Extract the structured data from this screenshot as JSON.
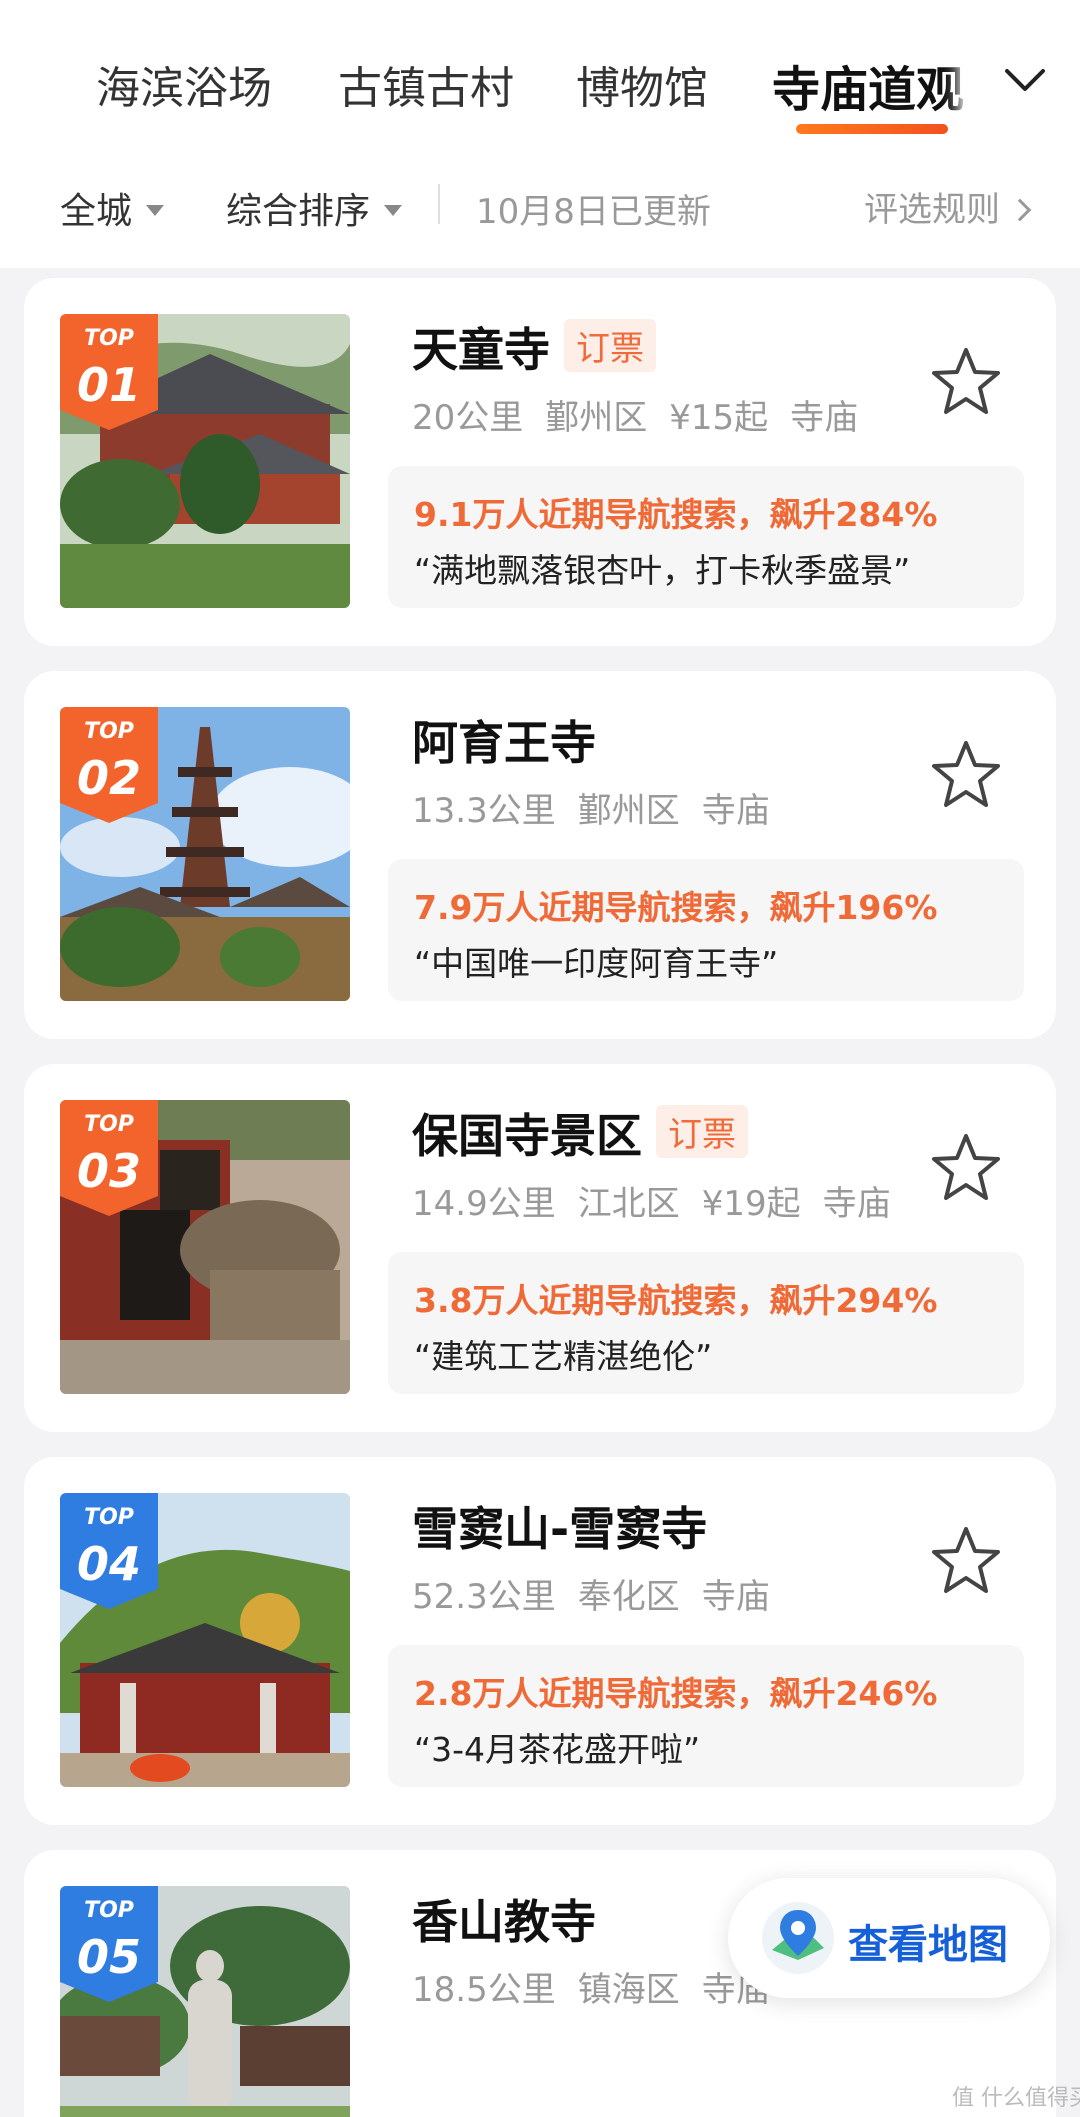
{
  "tabs": {
    "items": [
      "海滨浴场",
      "古镇古村",
      "博物馆",
      "寺庙道观"
    ],
    "active_index": 3
  },
  "filters": {
    "area": "全城",
    "sort": "综合排序",
    "updated": "10月8日已更新",
    "rules": "评选规则"
  },
  "list": [
    {
      "badge_top": "TOP",
      "rank": "01",
      "badge_color": "#f2642b",
      "name": "天童寺",
      "ticket": "订票",
      "distance": "20公里",
      "district": "鄞州区",
      "price": "¥15起",
      "category": "寺庙",
      "hot": "9.1万人近期导航搜索，飙升284%",
      "quote": "“满地飘落银杏叶，打卡秋季盛景”"
    },
    {
      "badge_top": "TOP",
      "rank": "02",
      "badge_color": "#f2642b",
      "name": "阿育王寺",
      "ticket": "",
      "distance": "13.3公里",
      "district": "鄞州区",
      "price": "",
      "category": "寺庙",
      "hot": "7.9万人近期导航搜索，飙升196%",
      "quote": "“中国唯一印度阿育王寺”"
    },
    {
      "badge_top": "TOP",
      "rank": "03",
      "badge_color": "#f2642b",
      "name": "保国寺景区",
      "ticket": "订票",
      "distance": "14.9公里",
      "district": "江北区",
      "price": "¥19起",
      "category": "寺庙",
      "hot": "3.8万人近期导航搜索，飙升294%",
      "quote": "“建筑工艺精湛绝伦”"
    },
    {
      "badge_top": "TOP",
      "rank": "04",
      "badge_color": "#2f7de1",
      "name": "雪窦山-雪窦寺",
      "ticket": "",
      "distance": "52.3公里",
      "district": "奉化区",
      "price": "",
      "category": "寺庙",
      "hot": "2.8万人近期导航搜索，飙升246%",
      "quote": "“3-4月茶花盛开啦”"
    },
    {
      "badge_top": "TOP",
      "rank": "05",
      "badge_color": "#2f7de1",
      "name": "香山教寺",
      "ticket": "",
      "distance": "18.5公里",
      "district": "镇海区",
      "price": "",
      "category": "寺庙",
      "hot": "",
      "quote": ""
    }
  ],
  "map_button": {
    "label": "查看地图",
    "icon": "map-pin-icon"
  },
  "watermark": "值 什么值得买",
  "colors": {
    "accent": "#f2642b",
    "hot_text": "#ef6a36",
    "map_blue": "#1560d8"
  }
}
